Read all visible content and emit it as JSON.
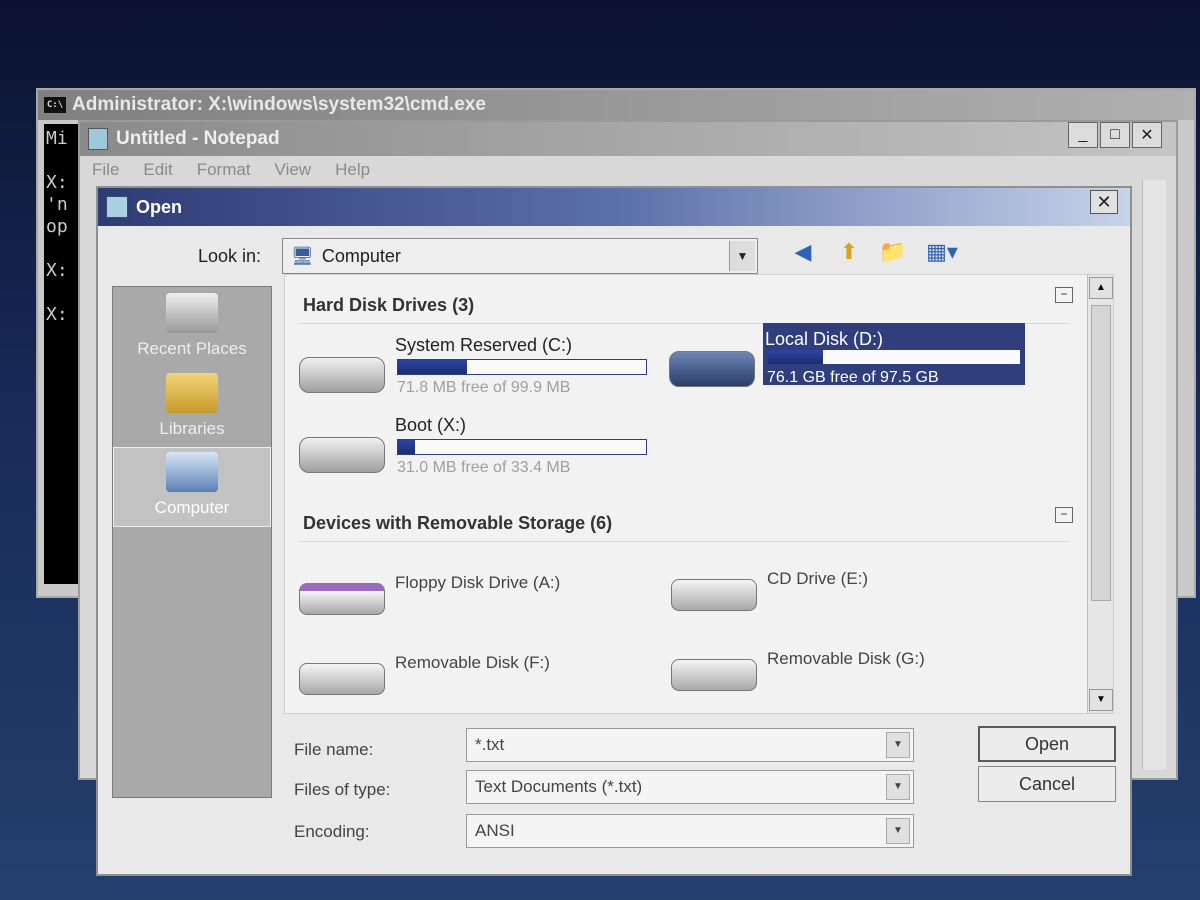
{
  "cmd": {
    "title": "Administrator: X:\\windows\\system32\\cmd.exe",
    "lines": "Mi\n\nX:\n'n\nop\n\nX:\n\nX:"
  },
  "notepad": {
    "title": "Untitled - Notepad",
    "menu": [
      "File",
      "Edit",
      "Format",
      "View",
      "Help"
    ]
  },
  "dialog": {
    "title": "Open",
    "look_in_label": "Look in:",
    "look_in_value": "Computer",
    "places": [
      "Recent Places",
      "Libraries",
      "Computer"
    ],
    "groups": {
      "hard_disks": "Hard Disk Drives (3)",
      "removable": "Devices with Removable Storage (6)"
    },
    "drives": [
      {
        "name": "System Reserved (C:)",
        "free": "71.8 MB free of 99.9 MB",
        "used_fraction": 0.28
      },
      {
        "name": "Local Disk (D:)",
        "free": "76.1 GB free of 97.5 GB",
        "used_fraction": 0.22
      },
      {
        "name": "Boot (X:)",
        "free": "31.0 MB free of 33.4 MB",
        "used_fraction": 0.07
      }
    ],
    "removable": [
      "Floppy Disk Drive (A:)",
      "CD Drive (E:)",
      "Removable Disk (F:)",
      "Removable Disk (G:)"
    ],
    "file_name_label": "File name:",
    "file_name_value": "*.txt",
    "file_type_label": "Files of type:",
    "file_type_value": "Text Documents (*.txt)",
    "encoding_label": "Encoding:",
    "encoding_value": "ANSI",
    "open_label": "Open",
    "cancel_label": "Cancel"
  }
}
